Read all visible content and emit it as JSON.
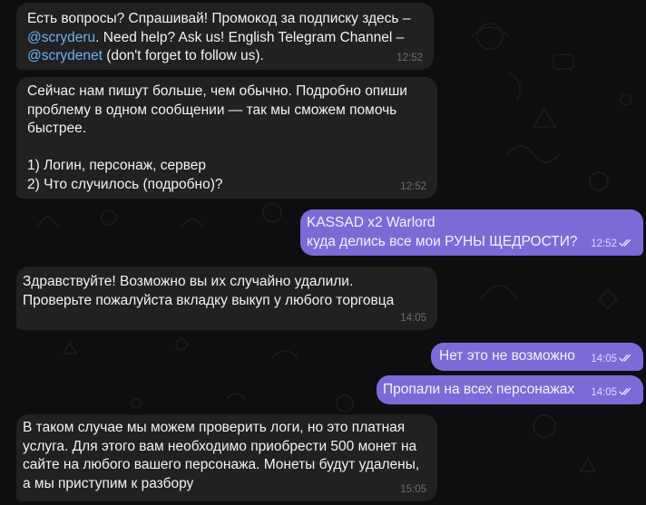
{
  "messages": [
    {
      "id": "m1",
      "direction": "incoming",
      "parts": [
        {
          "text": "Есть вопросы? Спрашивай! Промокод за подписку здесь – ",
          "link": false
        },
        {
          "text": "@scryderu",
          "link": true
        },
        {
          "text": ". Need help? Ask us! English Telegram Channel – ",
          "link": false
        },
        {
          "text": "@scrydenet",
          "link": true
        },
        {
          "text": " (don't forget to follow us).",
          "link": false
        }
      ],
      "time": "12:52"
    },
    {
      "id": "m2",
      "direction": "incoming",
      "text": "Сейчас нам пишут больше, чем обычно. Подробно опиши проблему в одном сообщении — так мы сможем помочь быстрее.\n\n1) Логин, персонаж, сервер\n2) Что случилось (подробно)?",
      "time": "12:52"
    },
    {
      "id": "m3",
      "direction": "outgoing",
      "text": "KASSAD x2 Warlord\nкуда делись все мои РУНЫ ЩЕДРОСТИ?",
      "time": "12:52",
      "read": true
    },
    {
      "id": "m4",
      "direction": "incoming",
      "text": "Здравствуйте! Возможно вы их случайно удалили.\nПроверьте пожалуйста вкладку выкуп у любого торговца",
      "time": "14:05"
    },
    {
      "id": "m5",
      "direction": "outgoing",
      "text": "Нет это не возможно",
      "time": "14:05",
      "read": true
    },
    {
      "id": "m6",
      "direction": "outgoing",
      "text": "Пропали на всех персонажах",
      "time": "14:05",
      "read": true
    },
    {
      "id": "m7",
      "direction": "incoming",
      "text": "В таком случае мы можем проверить логи, но это платная услуга. Для этого вам необходимо приобрести 500 монет на сайте на любого вашего персонажа. Монеты будут удалены, а мы приступим к разбору",
      "time": "15:05"
    }
  ],
  "colors": {
    "background": "#0e0e10",
    "incoming_bubble": "#212121",
    "outgoing_bubble": "#7b6bd6",
    "link": "#6ab3f3"
  },
  "icons": {
    "read_receipt": "double-check-icon",
    "background_pattern": "doodle-pattern"
  }
}
